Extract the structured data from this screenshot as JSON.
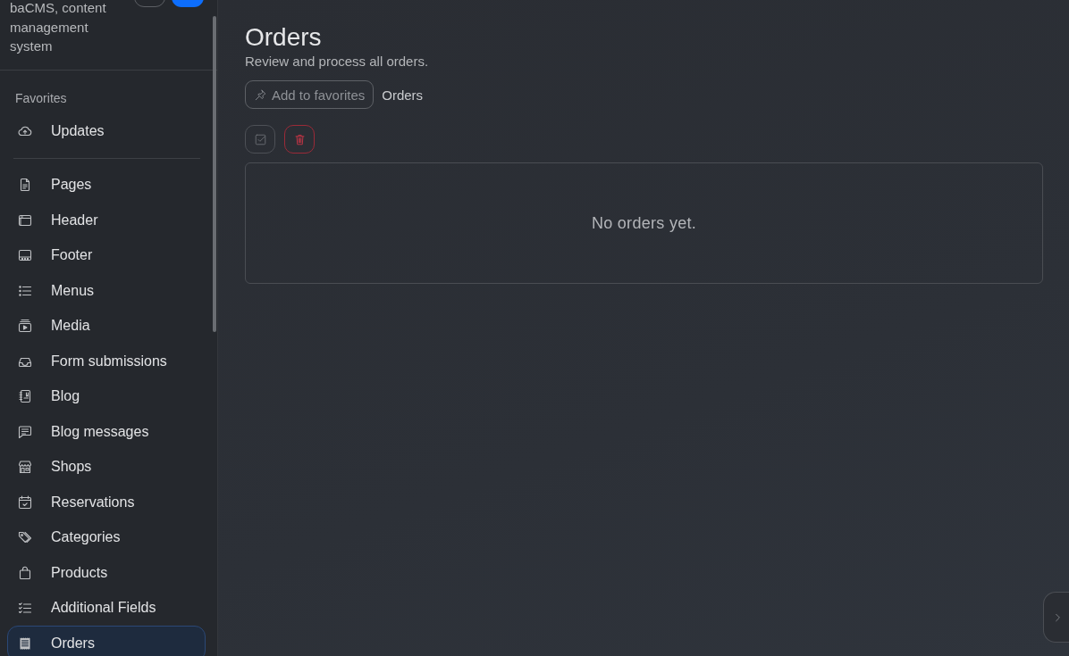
{
  "sidebar": {
    "site_name": "baCMS, content management system",
    "favorites": {
      "heading": "Favorites",
      "items": [
        {
          "label": "Updates",
          "selected": false
        }
      ]
    },
    "items": [
      {
        "label": "Pages",
        "selected": false
      },
      {
        "label": "Header",
        "selected": false
      },
      {
        "label": "Footer",
        "selected": false
      },
      {
        "label": "Menus",
        "selected": false
      },
      {
        "label": "Media",
        "selected": false
      },
      {
        "label": "Form submissions",
        "selected": false
      },
      {
        "label": "Blog",
        "selected": false
      },
      {
        "label": "Blog messages",
        "selected": false
      },
      {
        "label": "Shops",
        "selected": false
      },
      {
        "label": "Reservations",
        "selected": false
      },
      {
        "label": "Categories",
        "selected": false
      },
      {
        "label": "Products",
        "selected": false
      },
      {
        "label": "Additional Fields",
        "selected": false
      },
      {
        "label": "Orders",
        "selected": true
      }
    ]
  },
  "page": {
    "title": "Orders",
    "subtitle": "Review and process all orders.",
    "favorite_button": "Add to favorites",
    "breadcrumb": "Orders",
    "empty_message": "No orders yet."
  }
}
